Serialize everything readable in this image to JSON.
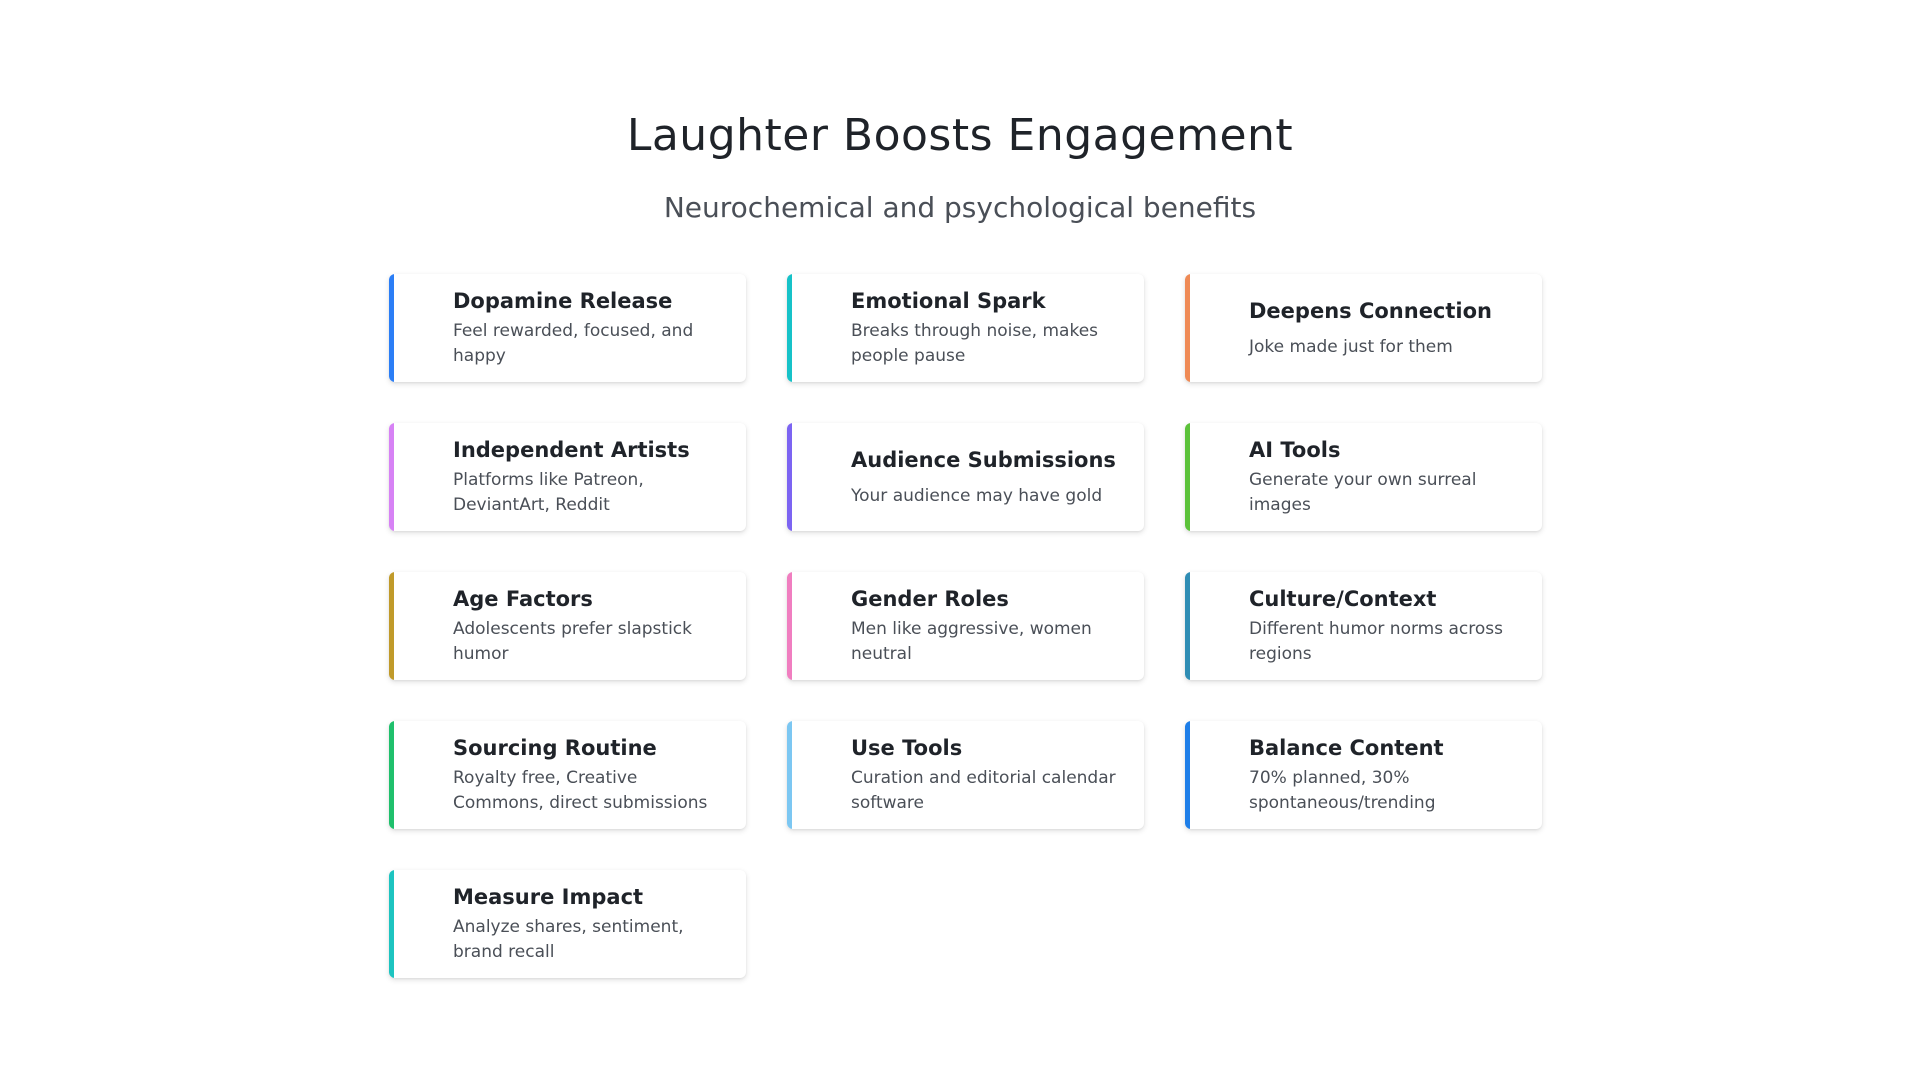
{
  "header": {
    "title": "Laughter Boosts Engagement",
    "subtitle": "Neurochemical and psychological benefits"
  },
  "cards": [
    {
      "title": "Dopamine Release",
      "description": "Feel rewarded, focused, and happy",
      "accent_color": "#2b7ef6"
    },
    {
      "title": "Emotional Spark",
      "description": "Breaks through noise, makes people pause",
      "accent_color": "#16c2c8"
    },
    {
      "title": "Deepens Connection",
      "description": "Joke made just for them",
      "accent_color": "#ef8a55"
    },
    {
      "title": "Independent Artists",
      "description": "Platforms like Patreon, DeviantArt, Reddit",
      "accent_color": "#d782f5"
    },
    {
      "title": "Audience Submissions",
      "description": "Your audience may have gold",
      "accent_color": "#7c64f2"
    },
    {
      "title": "AI Tools",
      "description": "Generate your own surreal images",
      "accent_color": "#5cc23a"
    },
    {
      "title": "Age Factors",
      "description": "Adolescents prefer slapstick humor",
      "accent_color": "#c09a2a"
    },
    {
      "title": "Gender Roles",
      "description": "Men like aggressive, women neutral",
      "accent_color": "#f07ec0"
    },
    {
      "title": "Culture/Context",
      "description": "Different humor norms across regions",
      "accent_color": "#2f8db4"
    },
    {
      "title": "Sourcing Routine",
      "description": "Royalty free, Creative Commons, direct submissions",
      "accent_color": "#1fc06c"
    },
    {
      "title": "Use Tools",
      "description": "Curation and editorial calendar software",
      "accent_color": "#7cc7f2"
    },
    {
      "title": "Balance Content",
      "description": "70% planned, 30% spontaneous/trending",
      "accent_color": "#1e7ee8"
    },
    {
      "title": "Measure Impact",
      "description": "Analyze shares, sentiment, brand recall",
      "accent_color": "#1dc4c0"
    }
  ]
}
